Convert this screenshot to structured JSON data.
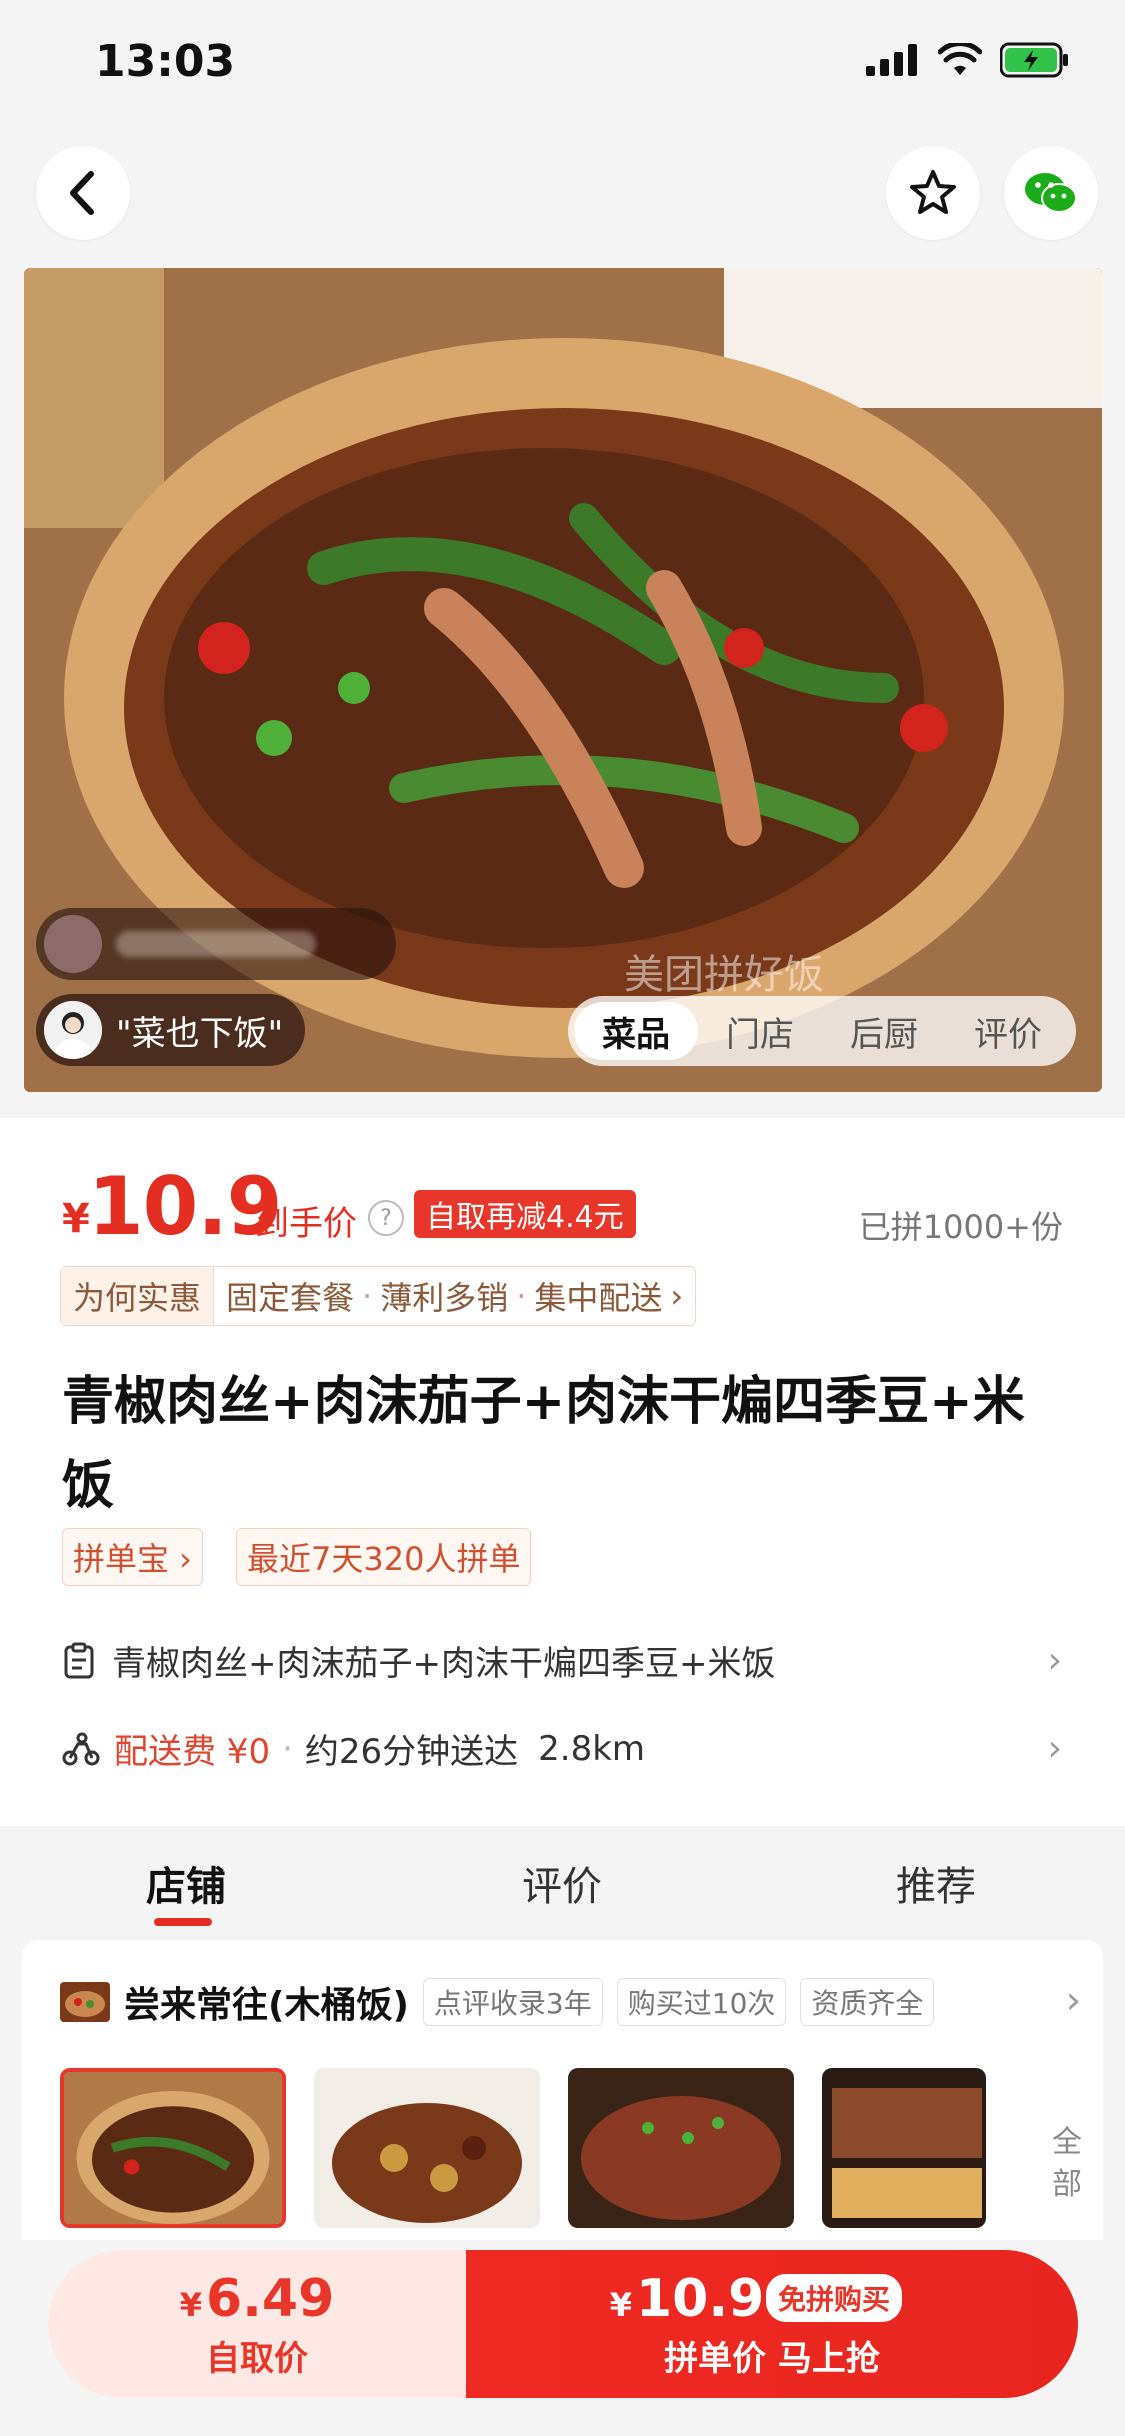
{
  "status": {
    "time": "13:03"
  },
  "hero": {
    "watermark": "美团拼好饭",
    "comments": [
      {
        "text": "\"菜也下饭\""
      }
    ],
    "tabs": [
      "菜品",
      "门店",
      "后厨",
      "评价"
    ]
  },
  "price": {
    "currency": "¥",
    "amount": "10.9",
    "label": "到手价",
    "help_icon": "?",
    "promo": "自取再减4.4元",
    "sold": "已拼1000+份"
  },
  "features": {
    "lead": "为何实惠",
    "items": [
      "固定套餐",
      "薄利多销",
      "集中配送"
    ]
  },
  "product": {
    "title": "青椒肉丝+肉沫茄子+肉沫干煸四季豆+米饭",
    "tags": [
      "拼单宝 ›",
      "最近7天320人拼单"
    ],
    "combo": "青椒肉丝+肉沫茄子+肉沫干煸四季豆+米饭",
    "delivery_fee_label": "配送费 ¥0",
    "delivery_time": "约26分钟送达",
    "distance": "2.8km"
  },
  "section_tabs": [
    "店铺",
    "评价",
    "推荐"
  ],
  "store": {
    "name": "尝来常往(木桶饭)",
    "tags": [
      "点评收录3年",
      "购买过10次",
      "资质齐全"
    ],
    "more": "全部"
  },
  "bottom": {
    "self_pickup_price": "6.49",
    "self_pickup_label": "自取价",
    "group_price": "10.9",
    "group_chip": "免拼购买",
    "group_label": "拼单价 马上抢",
    "currency": "¥"
  },
  "colors": {
    "accent": "#e52e22",
    "wechat": "#1aad19"
  }
}
